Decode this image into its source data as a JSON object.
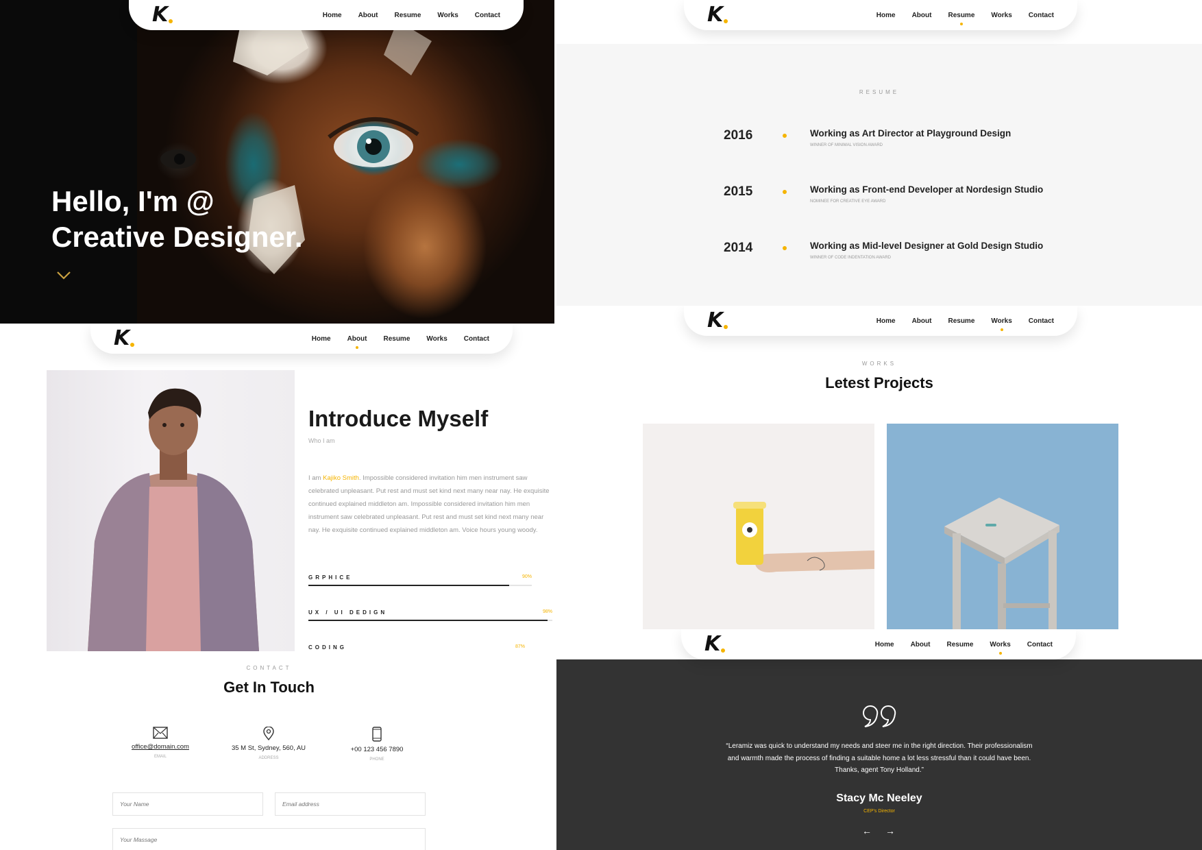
{
  "brand": {
    "logo": "K"
  },
  "nav": {
    "home": "Home",
    "about": "About",
    "resume": "Resume",
    "works": "Works",
    "contact": "Contact"
  },
  "hero": {
    "line1": "Hello, I'm @",
    "line2": "Creative Designer."
  },
  "resume": {
    "label": "RESUME",
    "items": [
      {
        "year": "2016",
        "title": "Working as Art Director at Playground Design",
        "sub": "WINNER OF MINIMAL VISION AWARD"
      },
      {
        "year": "2015",
        "title": "Working as Front-end Developer at Nordesign Studio",
        "sub": "NOMINEE FOR CREATIVE EYE AWARD"
      },
      {
        "year": "2014",
        "title": "Working as Mid-level Designer at Gold Design Studio",
        "sub": "WINNER OF CODE INDENTATION AWARD"
      }
    ]
  },
  "about": {
    "title": "Introduce Myself",
    "subtitle": "Who I am",
    "body_prefix": "I am ",
    "body_name": "Kajiko Smith",
    "body_rest": ". Impossible considered invitation him men instrument saw celebrated unpleasant. Put rest and must set kind next many near nay. He exquisite continued explained middleton am. Impossible considered invitation him men instrument saw celebrated unpleasant. Put rest and must set kind next many near nay. He exquisite continued explained middleton am. Voice hours young woody.",
    "skills": [
      {
        "name": "GRPHICE",
        "percent_label": "90%",
        "value": 0.9
      },
      {
        "name": "UX / UI DEDIGN",
        "percent_label": "98%",
        "value": 0.98
      },
      {
        "name": "CODING",
        "percent_label": "87%",
        "value": 0.87
      }
    ]
  },
  "contact": {
    "label": "CONTACT",
    "title": "Get In Touch",
    "email": {
      "value": "office@domain.com",
      "caption": "EMAIL",
      "icon": "envelope-icon"
    },
    "address": {
      "value": "35 M St, Sydney, 560, AU",
      "caption": "ADDRESS",
      "icon": "map-pin-icon"
    },
    "phone": {
      "value": "+00 123 456 7890",
      "caption": "PHONE",
      "icon": "phone-icon"
    },
    "form": {
      "name_placeholder": "Your Name",
      "email_placeholder": "Email address",
      "message_placeholder": "Your Massage"
    }
  },
  "works": {
    "label": "WORKS",
    "title": "Letest Projects"
  },
  "testimonial": {
    "quote": "“Leramiz was quick to understand my needs and steer me in the right direction. Their professionalism and warmth made the process of finding a suitable home a lot less stressful than it could have been. Thanks, agent Tony Holland.”",
    "name": "Stacy Mc Neeley",
    "role": "CEP's Director"
  },
  "colors": {
    "accent": "#f5b400",
    "dark": "#333333",
    "text": "#222222"
  }
}
